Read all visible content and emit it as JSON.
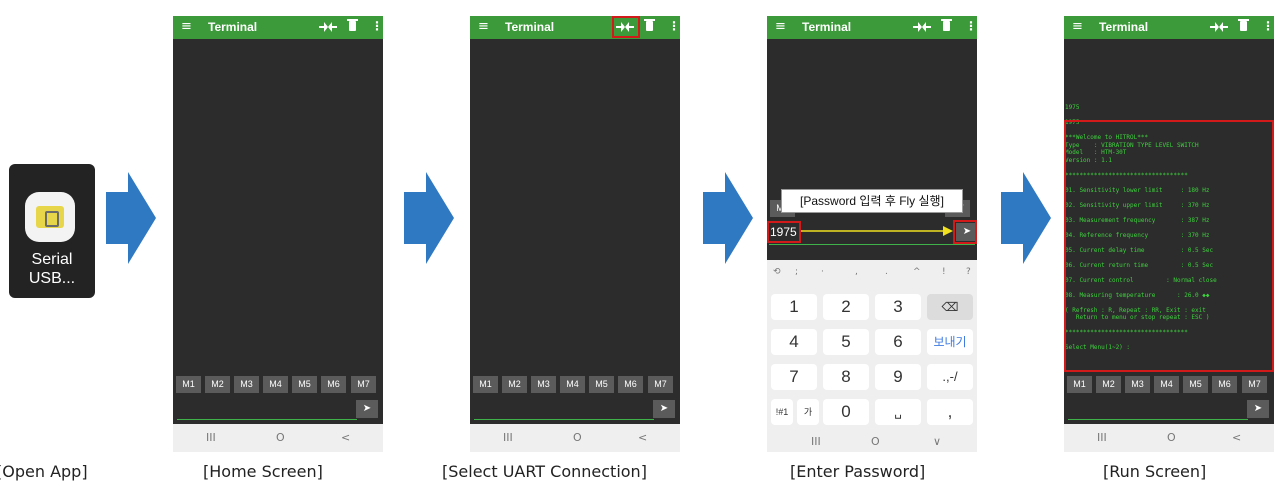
{
  "app": {
    "label_line1": "Serial",
    "label_line2": "USB..."
  },
  "captions": [
    "[Open App]",
    "[Home Screen]",
    "[Select UART Connection]",
    "[Enter Password]",
    "[Run Screen]"
  ],
  "terminal": {
    "title": "Terminal",
    "menu_glyph": "≡",
    "more_glyph": "⋮"
  },
  "macros": [
    "M1",
    "M2",
    "M3",
    "M4",
    "M5",
    "M6",
    "M7"
  ],
  "send_glyph": "➤",
  "nav": {
    "recent": "III",
    "home": "O",
    "back": "<"
  },
  "password": {
    "value": "1975",
    "annotation": "[Password 입력 후 Fly 실행]"
  },
  "keyboard": {
    "symbols": [
      "⟲",
      ";",
      "·",
      ",",
      ".",
      "^",
      "!",
      "?"
    ],
    "rows": [
      [
        "1",
        "2",
        "3",
        "⌫"
      ],
      [
        "4",
        "5",
        "6",
        "보내기"
      ],
      [
        "7",
        "8",
        "9",
        ".,-/"
      ],
      [
        "!#1",
        "가",
        "0",
        "␣",
        ","
      ]
    ],
    "nav_extra": "∨"
  },
  "run": {
    "lines": [
      "1975",
      "",
      "1975",
      "",
      "***Welcome to HITROL***",
      "Type    : VIBRATION TYPE LEVEL SWITCH",
      "Model   : HTM-30T",
      "Version : 1.1",
      "",
      "**********************************",
      "",
      "01. Sensitivity lower limit     : 180 Hz",
      "",
      "02. Sensitivity upper limit     : 370 Hz",
      "",
      "03. Measurement frequency       : 387 Hz",
      "",
      "04. Reference frequency         : 370 Hz",
      "",
      "05. Current delay time          : 0.5 Sec",
      "",
      "06. Current return time         : 0.5 Sec",
      "",
      "07. Current control         : Normal close",
      "",
      "08. Measuring temperature      : 26.0 ◆◆",
      "",
      "( Refresh : R, Repeat : RR, Exit : exit",
      "   Return to menu or stop repeat : ESC )",
      "",
      "**********************************",
      "",
      "Select Menu(1~2) :"
    ]
  },
  "colors": {
    "green_bar": "#3c9a3a",
    "screen": "#2c2c2c",
    "button": "#5b5b5b",
    "highlight": "#d21a1a",
    "arrow": "#2f79c3",
    "terminal_text": "#3ed13e"
  }
}
